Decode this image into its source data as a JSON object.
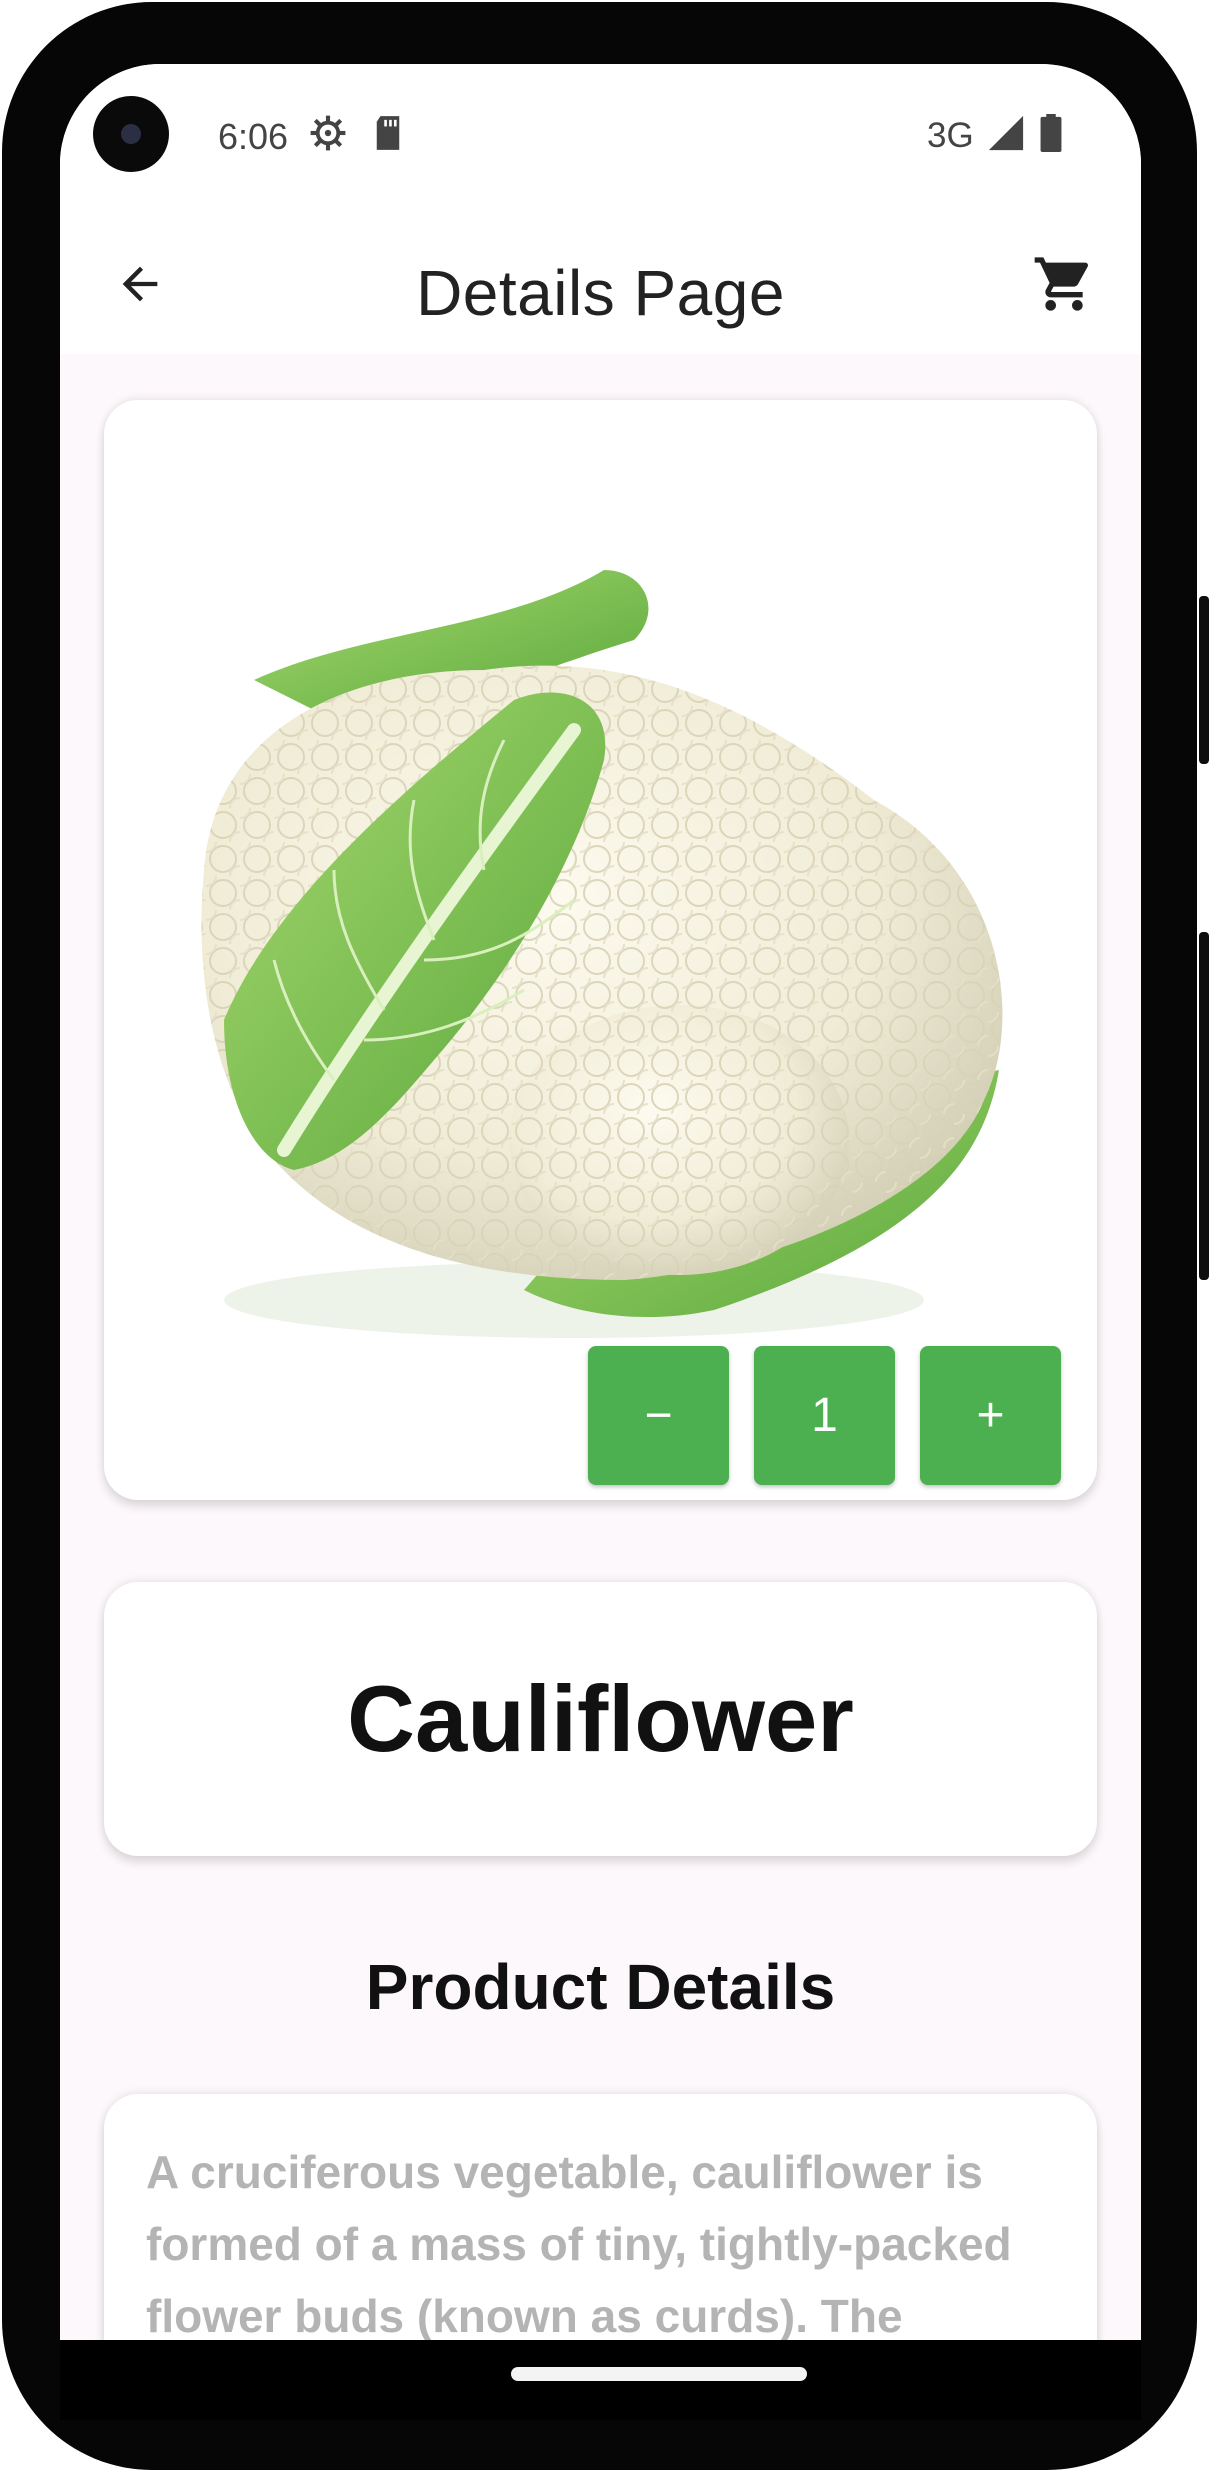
{
  "status_bar": {
    "time": "6:06",
    "network": "3G",
    "icons": [
      "settings-gear-icon",
      "sd-card-icon",
      "signal-icon",
      "battery-icon"
    ]
  },
  "app_bar": {
    "title": "Details Page",
    "back_icon": "arrow-left-icon",
    "cart_icon": "shopping-cart-icon"
  },
  "product": {
    "image": "cauliflower",
    "name": "Cauliflower",
    "quantity": "1",
    "decrement_label": "−",
    "increment_label": "+"
  },
  "details": {
    "title": "Product Details",
    "description": "A cruciferous vegetable, cauliflower is formed of a mass of tiny, tightly-packed flower buds (known as curds). The"
  },
  "colors": {
    "accent": "#4caf50",
    "background": "#fdf8fc",
    "description_text": "#b4b4b4"
  }
}
